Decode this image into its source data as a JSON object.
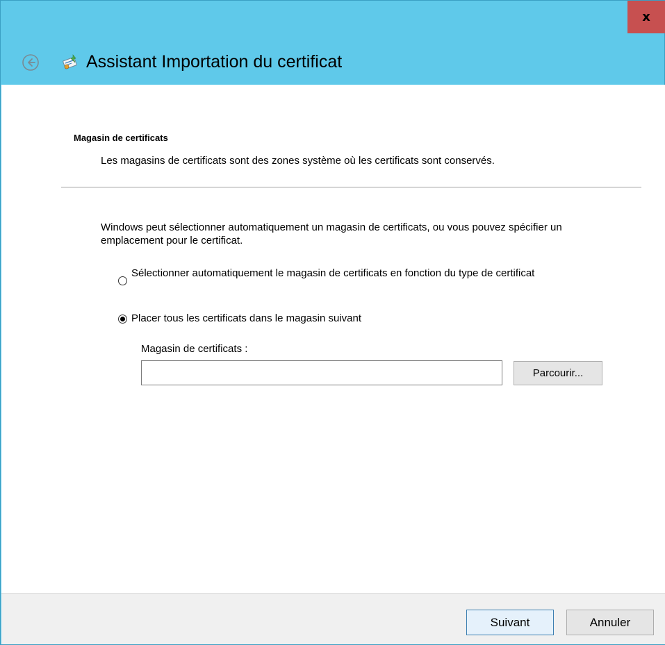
{
  "window": {
    "close_label": "x",
    "title": "Assistant Importation du certificat"
  },
  "icons": {
    "back": "back-arrow-icon",
    "wizard": "certificate-wizard-icon"
  },
  "page": {
    "section_title": "Magasin de certificats",
    "section_description": "Les magasins de certificats sont des zones système où les certificats sont conservés.",
    "intro": "Windows peut sélectionner automatiquement un magasin de certificats, ou vous pouvez spécifier un emplacement pour le certificat.",
    "options": [
      {
        "label": "Sélectionner automatiquement le magasin de certificats en fonction du type de certificat",
        "selected": false
      },
      {
        "label": "Placer tous les certificats dans le magasin suivant",
        "selected": true
      }
    ],
    "store_label": "Magasin de certificats :",
    "store_value": "",
    "browse_label": "Parcourir..."
  },
  "footer": {
    "next_label": "Suivant",
    "cancel_label": "Annuler"
  },
  "colors": {
    "titlebar": "#5fc9ea",
    "close": "#c75050",
    "footer": "#f0f0f0"
  }
}
